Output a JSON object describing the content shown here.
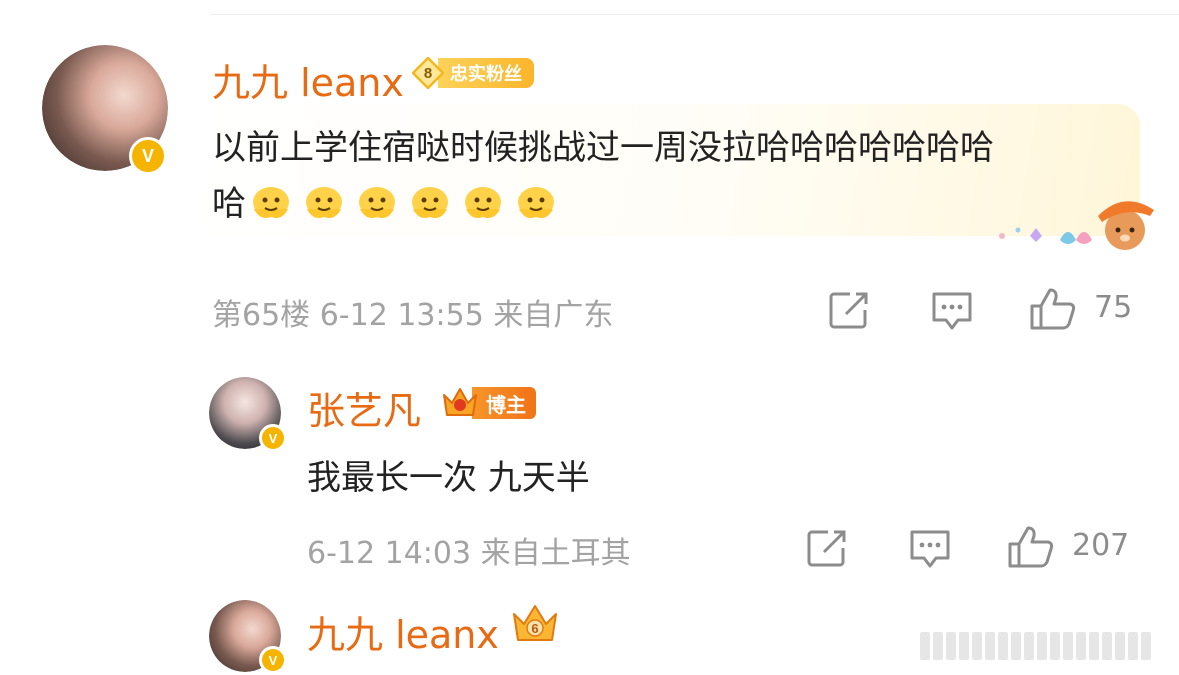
{
  "comment": {
    "username": "九九 leanx",
    "fan_level": "8",
    "fan_badge": "忠实粉丝",
    "text_line1": "以前上学住宿哒时候挑战过一周没拉哈哈哈哈哈哈哈",
    "text_line2_prefix": "哈",
    "emoji": [
      "melting-face-emoji",
      "melting-face-emoji",
      "melting-face-emoji",
      "melting-face-emoji",
      "melting-face-emoji",
      "melting-face-emoji"
    ],
    "meta": "第65楼 6-12 13:55 来自广东",
    "likes": "75",
    "verified_mark": "V"
  },
  "reply1": {
    "username": "张艺凡",
    "badge": "博主",
    "text": "我最长一次 九天半",
    "meta": "6-12 14:03 来自土耳其",
    "likes": "207",
    "verified_mark": "V"
  },
  "reply2": {
    "username": "九九 leanx",
    "crown_level": "6",
    "verified_mark": "V"
  },
  "icons": {
    "share": "share-icon",
    "comment": "comment-icon",
    "like": "thumbs-up-icon"
  },
  "colors": {
    "username": "#e86a12",
    "meta": "#a3a3a3",
    "verified": "#f5b400",
    "text": "#222222"
  }
}
